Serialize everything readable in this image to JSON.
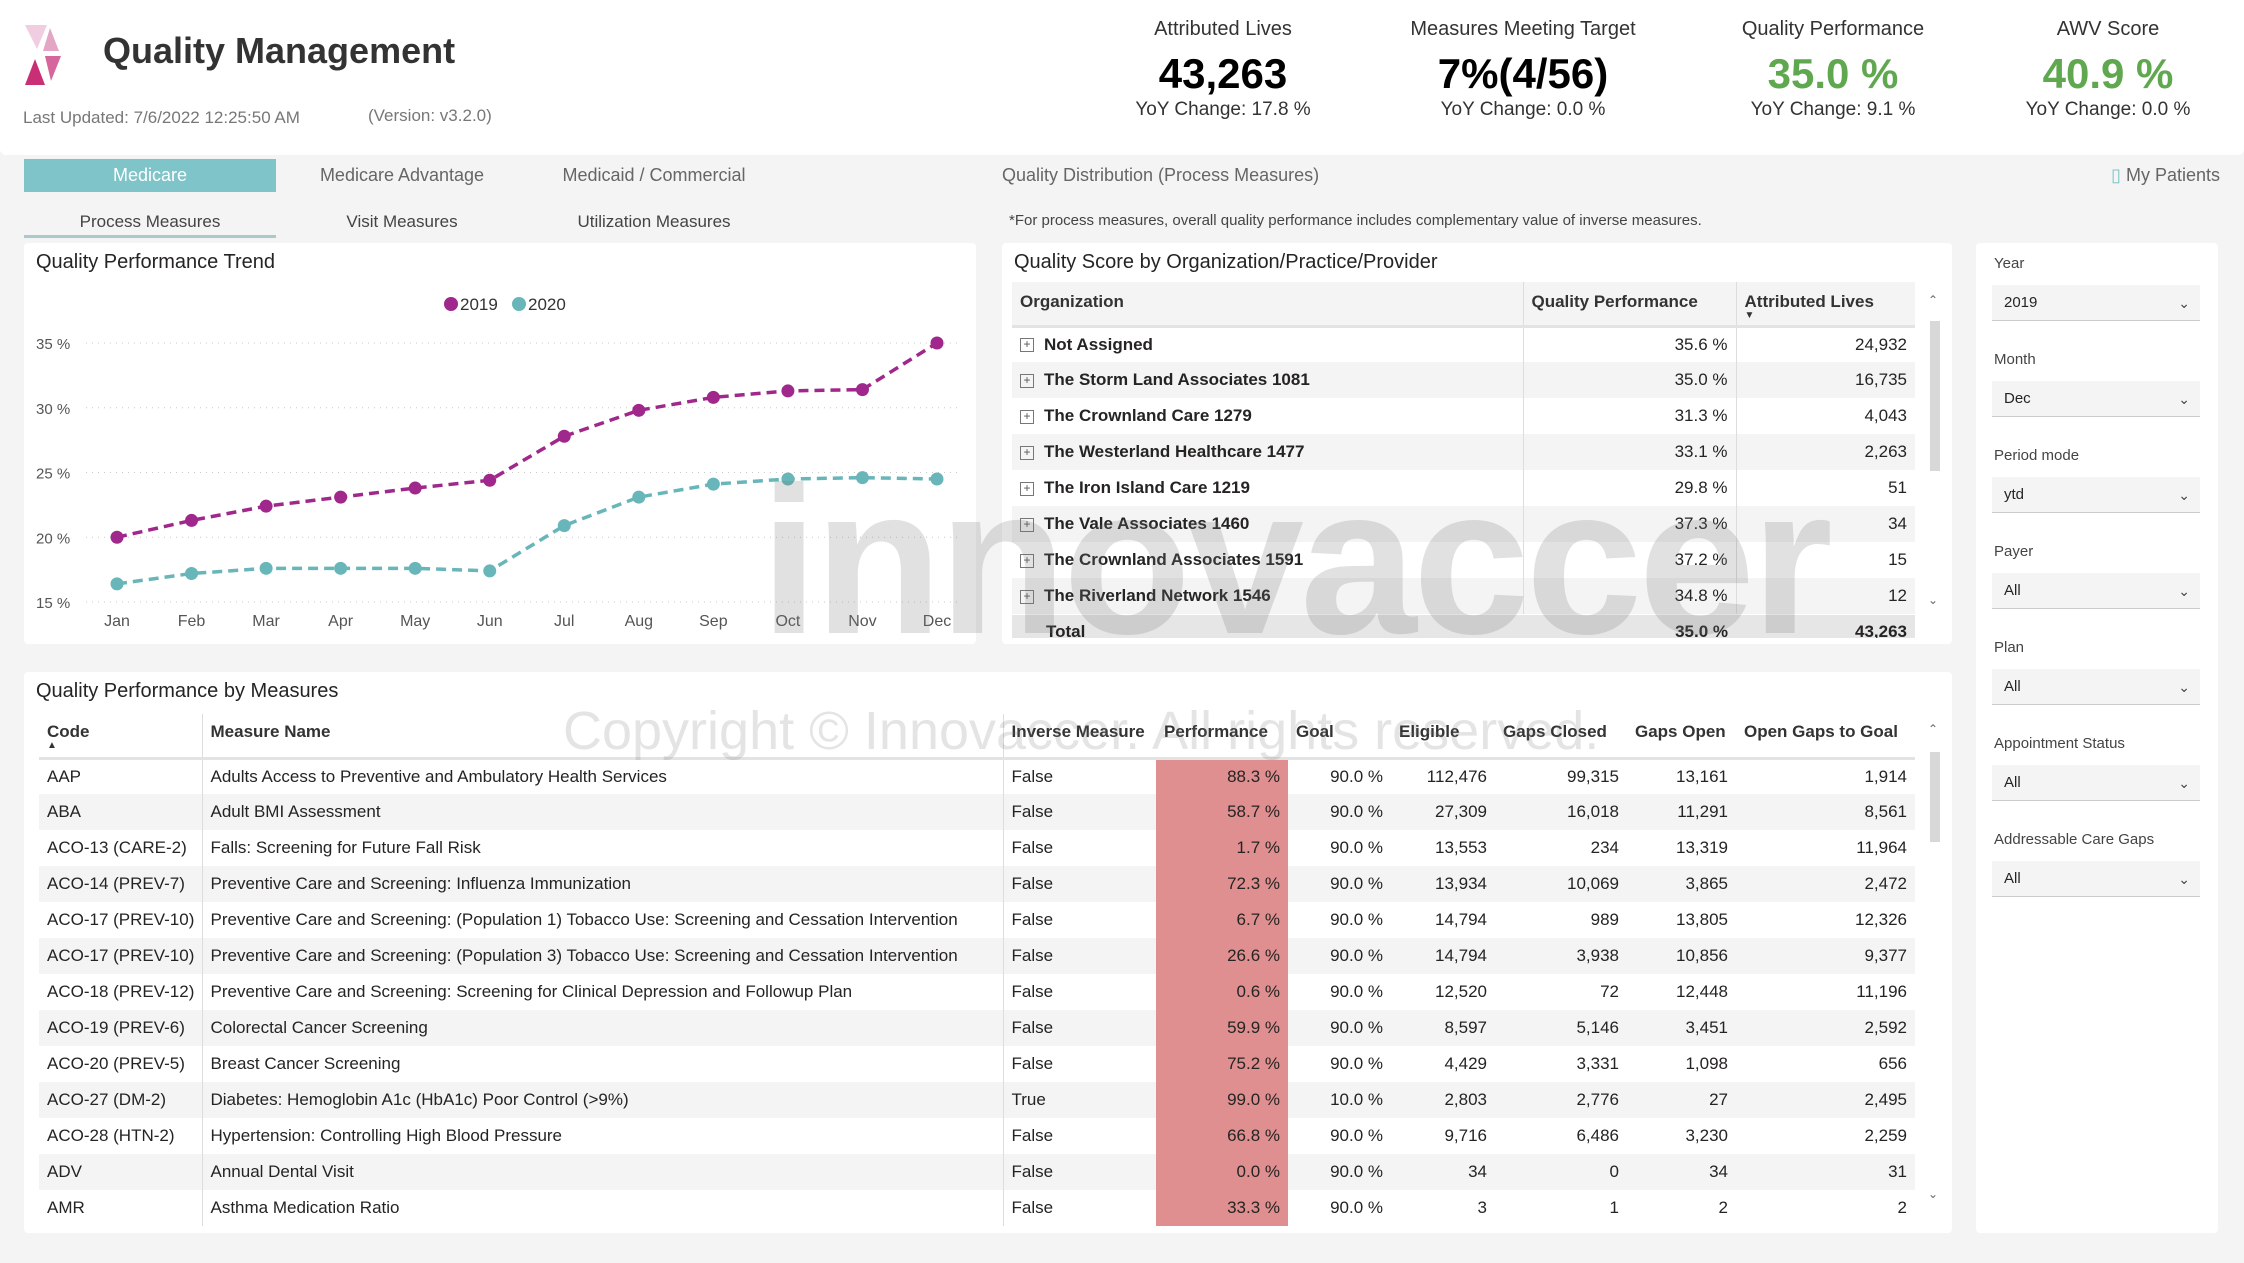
{
  "header": {
    "title": "Quality Management",
    "last_updated": "Last Updated: 7/6/2022 12:25:50 AM",
    "version": "(Version: v3.2.0)"
  },
  "kpis": [
    {
      "label": "Attributed Lives",
      "value": "43,263",
      "yoy": "YoY Change: 17.8 %",
      "color": "#000000"
    },
    {
      "label": "Measures Meeting Target",
      "value": "7%(4/56)",
      "yoy": "YoY Change: 0.0 %",
      "color": "#000000"
    },
    {
      "label": "Quality Performance",
      "value": "35.0 %",
      "yoy": "YoY Change: 9.1 %",
      "color": "#5fa84f"
    },
    {
      "label": "AWV Score",
      "value": "40.9 %",
      "yoy": "YoY Change: 0.0 %",
      "color": "#5fa84f"
    }
  ],
  "tabs": [
    "Medicare",
    "Medicare Advantage",
    "Medicaid / Commercial"
  ],
  "active_tab": "Medicare",
  "quality_distribution": "Quality Distribution (Process Measures)",
  "my_patients": "My Patients",
  "subtabs": [
    "Process Measures",
    "Visit Measures",
    "Utilization Measures"
  ],
  "note": "*For process measures, overall quality performance includes complementary value of inverse measures.",
  "watermark": {
    "brand": "innovaccer",
    "copyright": "Copyright © Innovaccer. All rights reserved."
  },
  "trend": {
    "title": "Quality Performance Trend"
  },
  "chart_data": {
    "type": "line",
    "title": "Quality Performance Trend",
    "categories": [
      "Jan",
      "Feb",
      "Mar",
      "Apr",
      "May",
      "Jun",
      "Jul",
      "Aug",
      "Sep",
      "Oct",
      "Nov",
      "Dec"
    ],
    "series": [
      {
        "name": "2019",
        "color": "#a0278b",
        "values": [
          20.0,
          21.3,
          22.4,
          23.1,
          23.8,
          24.4,
          27.8,
          29.8,
          30.8,
          31.3,
          31.4,
          35.0
        ]
      },
      {
        "name": "2020",
        "color": "#68b6b9",
        "values": [
          16.4,
          17.2,
          17.6,
          17.6,
          17.6,
          17.4,
          20.9,
          23.1,
          24.1,
          24.5,
          24.6,
          24.5
        ]
      }
    ],
    "yticks": [
      "15 %",
      "20 %",
      "25 %",
      "30 %",
      "35 %"
    ],
    "ylim": [
      15,
      35
    ],
    "grid": true,
    "legend": "top-center",
    "line_style": "dashed"
  },
  "org": {
    "title": "Quality Score by Organization/Practice/Provider",
    "columns": [
      "Organization",
      "Quality Performance",
      "Attributed Lives"
    ],
    "rows": [
      [
        "Not Assigned",
        "35.6 %",
        "24,932"
      ],
      [
        "The Storm Land Associates 1081",
        "35.0 %",
        "16,735"
      ],
      [
        "The Crownland Care 1279",
        "31.3 %",
        "4,043"
      ],
      [
        "The Westerland Healthcare 1477",
        "33.1 %",
        "2,263"
      ],
      [
        "The Iron Island Care 1219",
        "29.8 %",
        "51"
      ],
      [
        "The Vale Associates 1460",
        "37.3 %",
        "34"
      ],
      [
        "The Crownland Associates 1591",
        "37.2 %",
        "15"
      ],
      [
        "The Riverland Network 1546",
        "34.8 %",
        "12"
      ]
    ],
    "total": [
      "Total",
      "35.0 %",
      "43,263"
    ]
  },
  "measures": {
    "title": "Quality Performance by Measures",
    "columns": [
      "Code",
      "Measure Name",
      "Inverse Measure",
      "Performance",
      "Goal",
      "Eligible",
      "Gaps Closed",
      "Gaps Open",
      "Open Gaps to Goal"
    ],
    "rows": [
      [
        "AAP",
        "Adults Access to Preventive and Ambulatory Health Services",
        "False",
        "88.3 %",
        "90.0 %",
        "112,476",
        "99,315",
        "13,161",
        "1,914"
      ],
      [
        "ABA",
        "Adult BMI Assessment",
        "False",
        "58.7 %",
        "90.0 %",
        "27,309",
        "16,018",
        "11,291",
        "8,561"
      ],
      [
        "ACO-13 (CARE-2)",
        "Falls: Screening for Future Fall Risk",
        "False",
        "1.7 %",
        "90.0 %",
        "13,553",
        "234",
        "13,319",
        "11,964"
      ],
      [
        "ACO-14 (PREV-7)",
        "Preventive Care and Screening: Influenza Immunization",
        "False",
        "72.3 %",
        "90.0 %",
        "13,934",
        "10,069",
        "3,865",
        "2,472"
      ],
      [
        "ACO-17 (PREV-10)",
        "Preventive Care and Screening: (Population 1) Tobacco Use: Screening and Cessation Intervention",
        "False",
        "6.7 %",
        "90.0 %",
        "14,794",
        "989",
        "13,805",
        "12,326"
      ],
      [
        "ACO-17 (PREV-10)",
        "Preventive Care and Screening: (Population 3) Tobacco Use: Screening and Cessation Intervention",
        "False",
        "26.6 %",
        "90.0 %",
        "14,794",
        "3,938",
        "10,856",
        "9,377"
      ],
      [
        "ACO-18 (PREV-12)",
        "Preventive Care and Screening: Screening for Clinical Depression and Followup Plan",
        "False",
        "0.6 %",
        "90.0 %",
        "12,520",
        "72",
        "12,448",
        "11,196"
      ],
      [
        "ACO-19 (PREV-6)",
        "Colorectal Cancer Screening",
        "False",
        "59.9 %",
        "90.0 %",
        "8,597",
        "5,146",
        "3,451",
        "2,592"
      ],
      [
        "ACO-20 (PREV-5)",
        "Breast Cancer Screening",
        "False",
        "75.2 %",
        "90.0 %",
        "4,429",
        "3,331",
        "1,098",
        "656"
      ],
      [
        "ACO-27 (DM-2)",
        "Diabetes: Hemoglobin A1c (HbA1c) Poor Control (>9%)",
        "True",
        "99.0 %",
        "10.0 %",
        "2,803",
        "2,776",
        "27",
        "2,495"
      ],
      [
        "ACO-28 (HTN-2)",
        "Hypertension: Controlling High Blood Pressure",
        "False",
        "66.8 %",
        "90.0 %",
        "9,716",
        "6,486",
        "3,230",
        "2,259"
      ],
      [
        "ADV",
        "Annual Dental Visit",
        "False",
        "0.0 %",
        "90.0 %",
        "34",
        "0",
        "34",
        "31"
      ],
      [
        "AMR",
        "Asthma Medication Ratio",
        "False",
        "33.3 %",
        "90.0 %",
        "3",
        "1",
        "2",
        "2"
      ]
    ],
    "performance_color": "#df8f8f"
  },
  "filters": [
    {
      "label": "Year",
      "value": "2019"
    },
    {
      "label": "Month",
      "value": "Dec"
    },
    {
      "label": "Period mode",
      "value": "ytd"
    },
    {
      "label": "Payer",
      "value": "All"
    },
    {
      "label": "Plan",
      "value": "All"
    },
    {
      "label": "Appointment Status",
      "value": "All"
    },
    {
      "label": "Addressable Care Gaps",
      "value": "All"
    }
  ]
}
